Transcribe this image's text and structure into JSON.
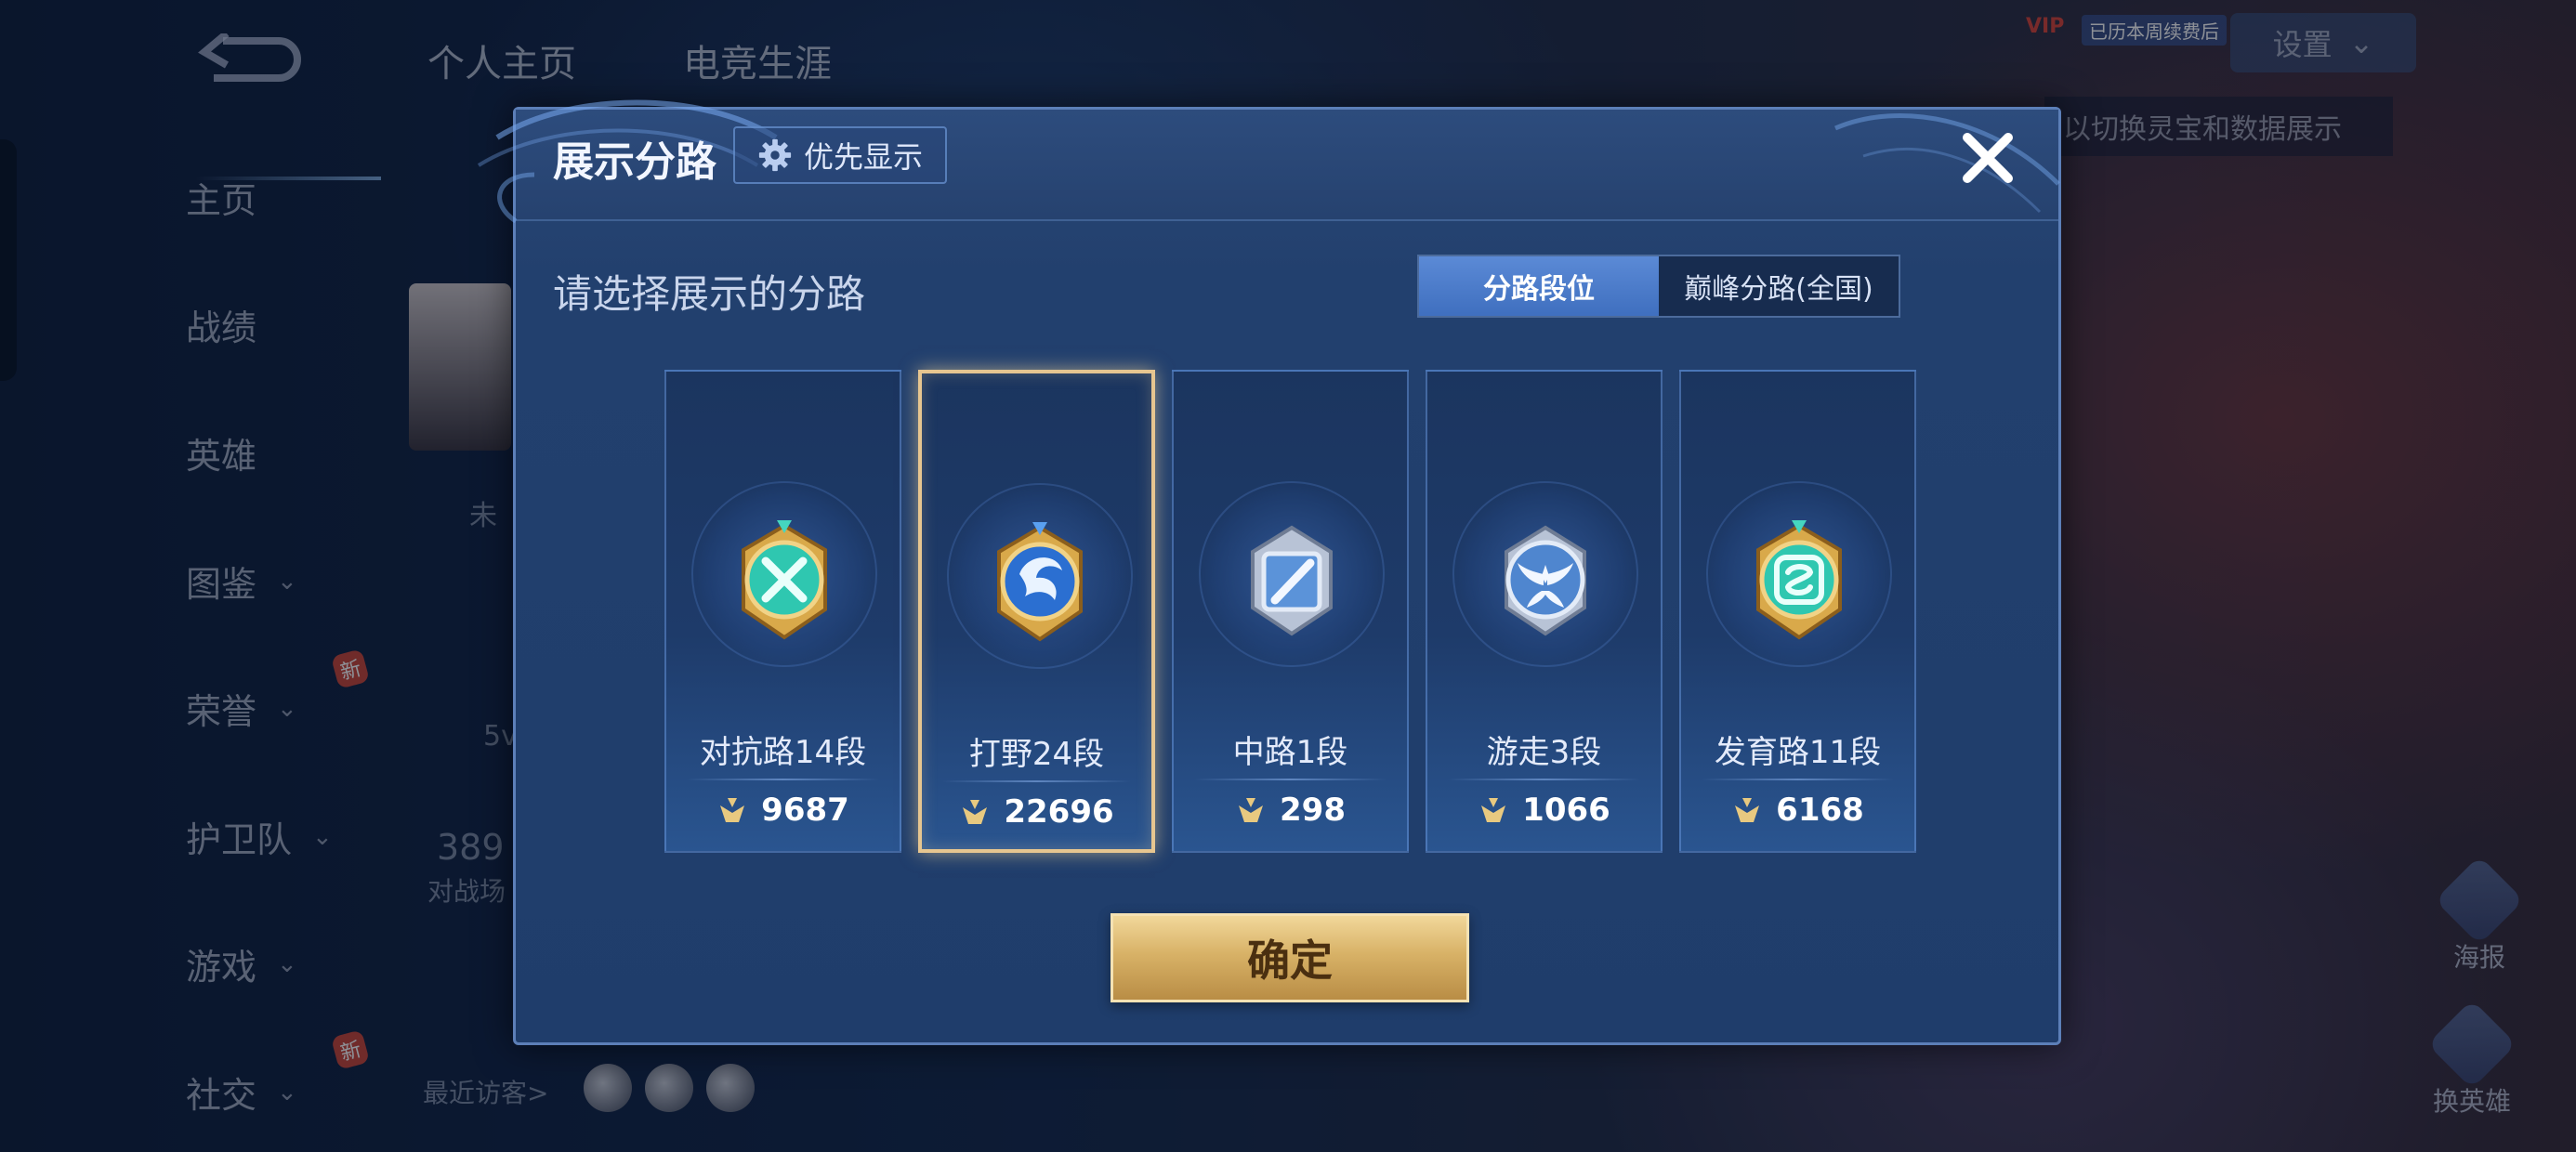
{
  "background": {
    "top_tabs": [
      "个人主页",
      "电竞生涯"
    ],
    "sidebar": [
      {
        "label": "主页",
        "has_chevron": false
      },
      {
        "label": "战绩",
        "has_chevron": false
      },
      {
        "label": "英雄",
        "has_chevron": false
      },
      {
        "label": "图鉴",
        "has_chevron": true
      },
      {
        "label": "荣誉",
        "has_chevron": true,
        "badge": "新"
      },
      {
        "label": "护卫队",
        "has_chevron": true
      },
      {
        "label": "游戏",
        "has_chevron": true
      },
      {
        "label": "社交",
        "has_chevron": true,
        "badge": "新"
      }
    ],
    "settings_label": "设置",
    "hint_text": "以切换灵宝和数据展示",
    "vip_label": "VIP",
    "vip_tag": "已历本周续费后",
    "profile_status": "未",
    "profile_text_a": "5v",
    "profile_number": "389",
    "profile_text_b": "对战场",
    "recent_visitors": "最近访客>",
    "right_buttons": [
      "海报",
      "换英雄"
    ]
  },
  "dialog": {
    "title": "展示分路",
    "priority_button": "优先显示",
    "prompt": "请选择展示的分路",
    "segments": [
      {
        "label": "分路段位",
        "active": true
      },
      {
        "label": "巅峰分路(全国)",
        "active": false
      }
    ],
    "lanes": [
      {
        "label": "对抗路14段",
        "score": "9687",
        "selected": false,
        "badge_style": "gold-teal",
        "icon": "cross-swords-icon"
      },
      {
        "label": "打野24段",
        "score": "22696",
        "selected": true,
        "badge_style": "gold-blue",
        "icon": "dragon-icon"
      },
      {
        "label": "中路1段",
        "score": "298",
        "selected": false,
        "badge_style": "silver",
        "icon": "slash-icon"
      },
      {
        "label": "游走3段",
        "score": "1066",
        "selected": false,
        "badge_style": "silver",
        "icon": "wings-icon"
      },
      {
        "label": "发育路11段",
        "score": "6168",
        "selected": false,
        "badge_style": "gold-teal",
        "icon": "bow-icon"
      }
    ],
    "confirm_button": "确定"
  },
  "colors": {
    "accent_blue": "#4f7fcf",
    "selected_gold": "#e7c690",
    "confirm_gold": "#d8b267"
  }
}
